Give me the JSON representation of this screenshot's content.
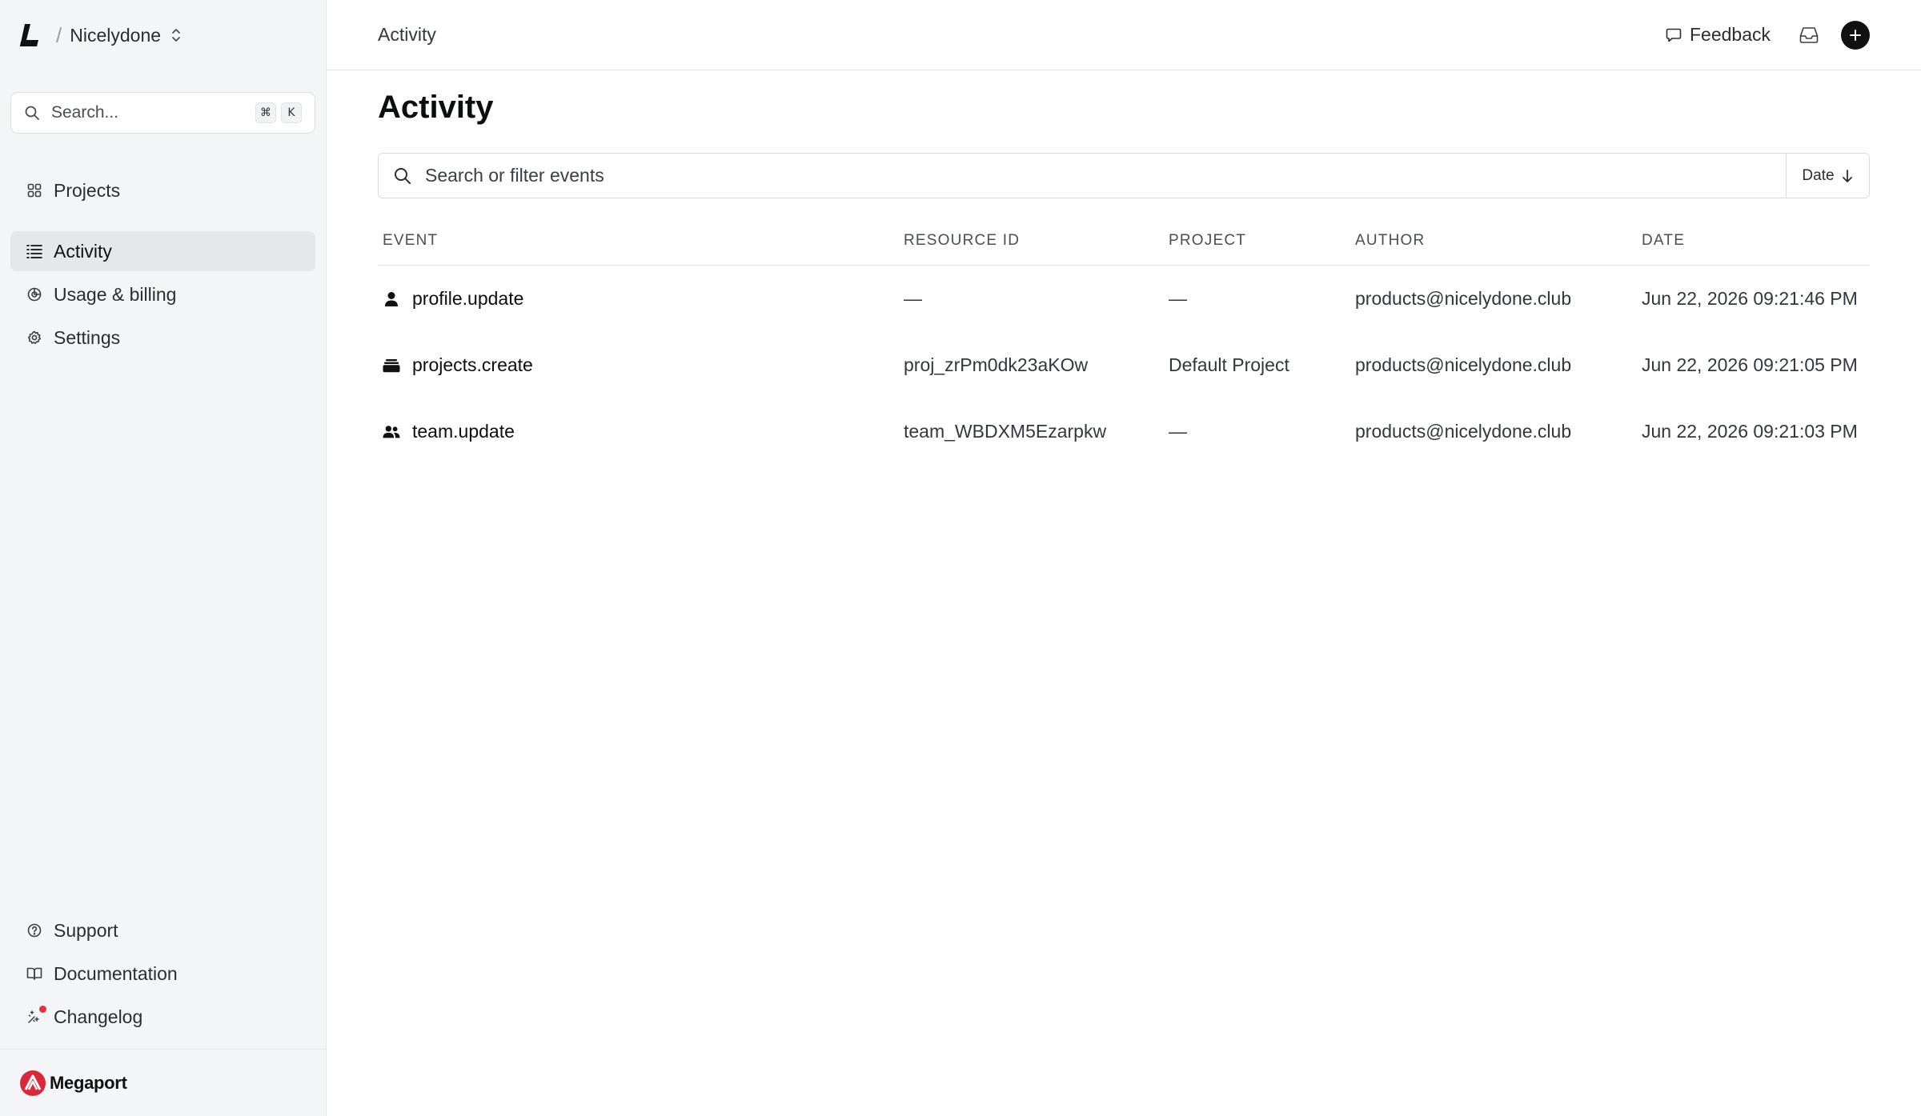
{
  "sidebar": {
    "team_name": "Nicelydone",
    "search": {
      "placeholder": "Search...",
      "shortcut": [
        "⌘",
        "K"
      ]
    },
    "nav": [
      {
        "label": "Projects",
        "icon": "grid-icon",
        "active": false
      },
      {
        "label": "Activity",
        "icon": "list-icon",
        "active": true
      },
      {
        "label": "Usage & billing",
        "icon": "chart-pie-icon",
        "active": false
      },
      {
        "label": "Settings",
        "icon": "gear-icon",
        "active": false
      }
    ],
    "bottom_nav": [
      {
        "label": "Support",
        "icon": "help-circle-icon"
      },
      {
        "label": "Documentation",
        "icon": "book-icon"
      },
      {
        "label": "Changelog",
        "icon": "sparkles-icon",
        "has_badge": true
      }
    ],
    "footer_brand": "Megaport"
  },
  "header": {
    "breadcrumb": "Activity",
    "feedback_label": "Feedback"
  },
  "main": {
    "title": "Activity",
    "filter": {
      "placeholder": "Search or filter events",
      "sort_label": "Date"
    },
    "columns": [
      "EVENT",
      "RESOURCE ID",
      "PROJECT",
      "AUTHOR",
      "DATE"
    ],
    "rows": [
      {
        "icon": "user-icon",
        "event": "profile.update",
        "resource_id": "—",
        "project": "—",
        "author": "products@nicelydone.club",
        "date": "Jun 22, 2026 09:21:46 PM"
      },
      {
        "icon": "layers-icon",
        "event": "projects.create",
        "resource_id": "proj_zrPm0dk23aKOw",
        "project": "Default Project",
        "author": "products@nicelydone.club",
        "date": "Jun 22, 2026 09:21:05 PM"
      },
      {
        "icon": "users-icon",
        "event": "team.update",
        "resource_id": "team_WBDXM5Ezarpkw",
        "project": "—",
        "author": "products@nicelydone.club",
        "date": "Jun 22, 2026 09:21:03 PM"
      }
    ]
  },
  "colors": {
    "sidebar_bg": "#f4f5f7",
    "active_bg": "#e6e7ea",
    "brand_red": "#d8283a"
  }
}
